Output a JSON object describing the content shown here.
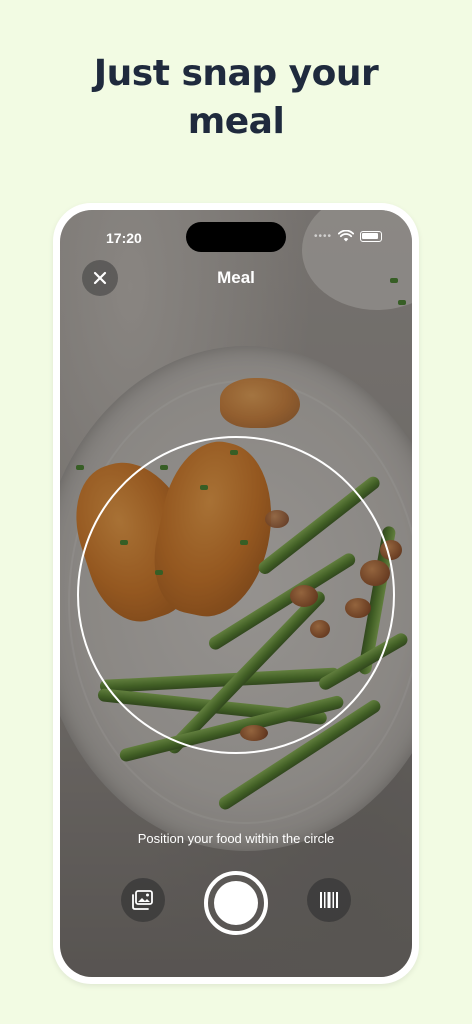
{
  "promo": {
    "headline_line1": "Just snap your",
    "headline_line2": "meal"
  },
  "status_bar": {
    "time": "17:20",
    "icons": [
      "cellular-dots-icon",
      "wifi-icon",
      "battery-icon"
    ]
  },
  "header": {
    "title": "Meal",
    "close_icon": "close-icon"
  },
  "camera": {
    "hint": "Position your food within the circle"
  },
  "controls": {
    "gallery_icon": "gallery-icon",
    "shutter_icon": "shutter-icon",
    "barcode_icon": "barcode-icon"
  },
  "colors": {
    "background": "#f2fbe3",
    "headline": "#1f2a3d",
    "phone_frame": "#ffffff"
  }
}
